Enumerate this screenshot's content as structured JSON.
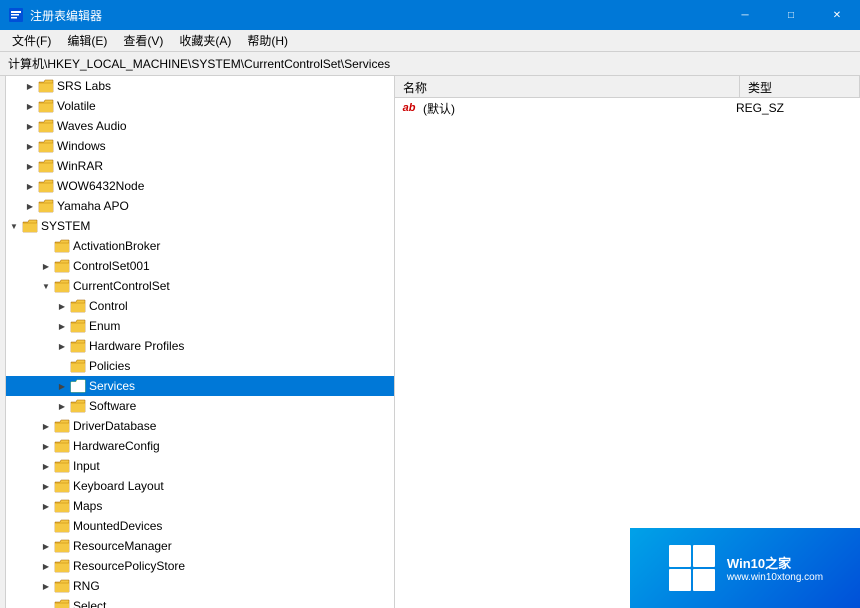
{
  "titleBar": {
    "title": "注册表编辑器",
    "minimizeLabel": "─",
    "maximizeLabel": "□",
    "closeLabel": "✕"
  },
  "menuBar": {
    "items": [
      "文件(F)",
      "编辑(E)",
      "查看(V)",
      "收藏夹(A)",
      "帮助(H)"
    ]
  },
  "addressBar": {
    "path": "计算机\\HKEY_LOCAL_MACHINE\\SYSTEM\\CurrentControlSet\\Services"
  },
  "treePane": {
    "items": [
      {
        "id": "srs-labs",
        "label": "SRS Labs",
        "indent": 2,
        "expanded": false,
        "hasChildren": true
      },
      {
        "id": "volatile",
        "label": "Volatile",
        "indent": 2,
        "expanded": false,
        "hasChildren": true
      },
      {
        "id": "waves-audio",
        "label": "Waves Audio",
        "indent": 2,
        "expanded": false,
        "hasChildren": true
      },
      {
        "id": "windows",
        "label": "Windows",
        "indent": 2,
        "expanded": false,
        "hasChildren": true
      },
      {
        "id": "winrar",
        "label": "WinRAR",
        "indent": 2,
        "expanded": false,
        "hasChildren": true
      },
      {
        "id": "wow6432node",
        "label": "WOW6432Node",
        "indent": 2,
        "expanded": false,
        "hasChildren": true
      },
      {
        "id": "yamaha-apo",
        "label": "Yamaha APO",
        "indent": 2,
        "expanded": false,
        "hasChildren": true
      },
      {
        "id": "system",
        "label": "SYSTEM",
        "indent": 1,
        "expanded": true,
        "hasChildren": true
      },
      {
        "id": "activation-broker",
        "label": "ActivationBroker",
        "indent": 3,
        "expanded": false,
        "hasChildren": false
      },
      {
        "id": "controlset001",
        "label": "ControlSet001",
        "indent": 3,
        "expanded": false,
        "hasChildren": true
      },
      {
        "id": "currentcontrolset",
        "label": "CurrentControlSet",
        "indent": 3,
        "expanded": true,
        "hasChildren": true
      },
      {
        "id": "control",
        "label": "Control",
        "indent": 4,
        "expanded": false,
        "hasChildren": true
      },
      {
        "id": "enum",
        "label": "Enum",
        "indent": 4,
        "expanded": false,
        "hasChildren": true
      },
      {
        "id": "hardware-profiles",
        "label": "Hardware Profiles",
        "indent": 4,
        "expanded": false,
        "hasChildren": true
      },
      {
        "id": "policies",
        "label": "Policies",
        "indent": 4,
        "expanded": false,
        "hasChildren": false
      },
      {
        "id": "services",
        "label": "Services",
        "indent": 4,
        "expanded": false,
        "hasChildren": true,
        "selected": true
      },
      {
        "id": "software",
        "label": "Software",
        "indent": 4,
        "expanded": false,
        "hasChildren": true
      },
      {
        "id": "driver-database",
        "label": "DriverDatabase",
        "indent": 3,
        "expanded": false,
        "hasChildren": true
      },
      {
        "id": "hardware-config",
        "label": "HardwareConfig",
        "indent": 3,
        "expanded": false,
        "hasChildren": true
      },
      {
        "id": "input",
        "label": "Input",
        "indent": 3,
        "expanded": false,
        "hasChildren": true
      },
      {
        "id": "keyboard-layout",
        "label": "Keyboard Layout",
        "indent": 3,
        "expanded": false,
        "hasChildren": true
      },
      {
        "id": "maps",
        "label": "Maps",
        "indent": 3,
        "expanded": false,
        "hasChildren": true
      },
      {
        "id": "mounted-devices",
        "label": "MountedDevices",
        "indent": 3,
        "expanded": false,
        "hasChildren": false
      },
      {
        "id": "resource-manager",
        "label": "ResourceManager",
        "indent": 3,
        "expanded": false,
        "hasChildren": true
      },
      {
        "id": "resource-policy-store",
        "label": "ResourcePolicyStore",
        "indent": 3,
        "expanded": false,
        "hasChildren": true
      },
      {
        "id": "rng",
        "label": "RNG",
        "indent": 3,
        "expanded": false,
        "hasChildren": true
      },
      {
        "id": "select",
        "label": "Select",
        "indent": 3,
        "expanded": false,
        "hasChildren": false
      }
    ]
  },
  "rightPane": {
    "columns": {
      "name": "名称",
      "type": "类型"
    },
    "rows": [
      {
        "id": "default",
        "icon": "ab",
        "name": "(默认)",
        "type": "REG_SZ"
      }
    ]
  },
  "watermark": {
    "title": "Win10之家",
    "subtitle": "www.win10xtong.com"
  }
}
